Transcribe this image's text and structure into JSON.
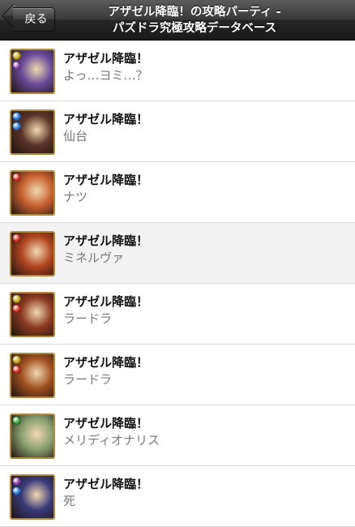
{
  "navbar": {
    "back_label": "戻る",
    "title_line1": "アザゼル降臨！の攻略パーティ -",
    "title_line2": "パズドラ究極攻略データベース"
  },
  "items": [
    {
      "title": "アザゼル降臨！",
      "subtitle": "よっ…ヨミ…？",
      "main_attr_color": "#c8a818",
      "sub_attr_color": "#8a3fb0",
      "art_color": "#6a4a9a"
    },
    {
      "title": "アザゼル降臨！",
      "subtitle": "仙台",
      "main_attr_color": "#2a78d8",
      "sub_attr_color": "#2a78d8",
      "art_color": "#5a3428"
    },
    {
      "title": "アザゼル降臨！",
      "subtitle": "ナツ",
      "main_attr_color": "#d83020",
      "sub_attr_color": "",
      "art_color": "#c86030"
    },
    {
      "title": "アザゼル降臨！",
      "subtitle": "ミネルヴァ",
      "main_attr_color": "#d83020",
      "sub_attr_color": "",
      "art_color": "#b04420"
    },
    {
      "title": "アザゼル降臨！",
      "subtitle": "ラードラ",
      "main_attr_color": "#c8a818",
      "sub_attr_color": "#d83020",
      "art_color": "#8a3a20"
    },
    {
      "title": "アザゼル降臨！",
      "subtitle": "ラードラ",
      "main_attr_color": "#c8a818",
      "sub_attr_color": "#d83020",
      "art_color": "#a05020"
    },
    {
      "title": "アザゼル降臨！",
      "subtitle": "メリディオナリス",
      "main_attr_color": "#38a038",
      "sub_attr_color": "",
      "art_color": "#8aa070"
    },
    {
      "title": "アザゼル降臨！",
      "subtitle": "死",
      "main_attr_color": "#8a3fb0",
      "sub_attr_color": "#2a78d8",
      "art_color": "#3a3a7a"
    }
  ],
  "highlighted_index": 3
}
